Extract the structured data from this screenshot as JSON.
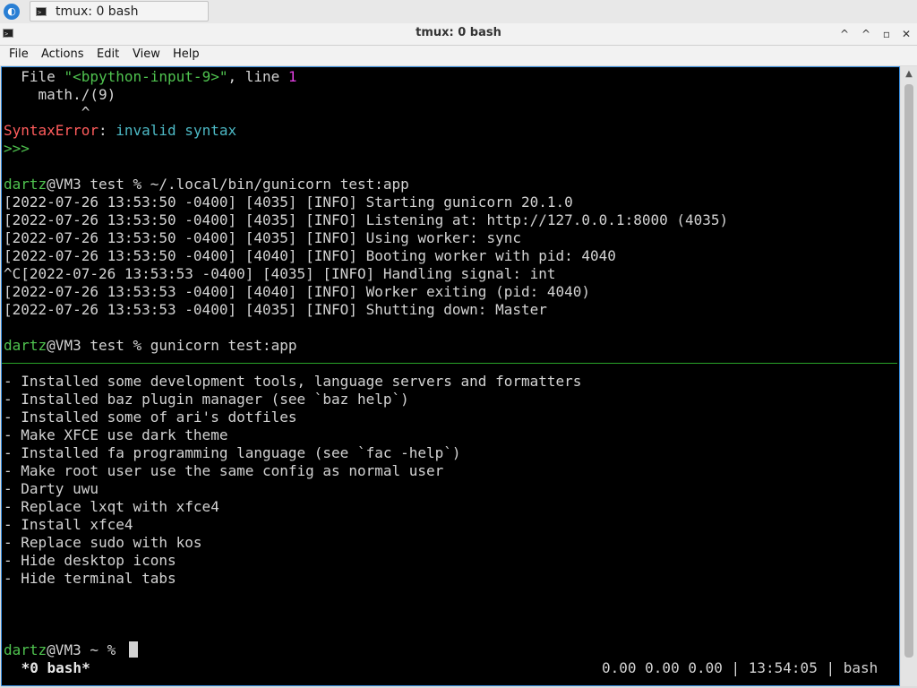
{
  "taskbar": {
    "task_label": "tmux: 0 bash"
  },
  "window": {
    "title": "tmux: 0 bash",
    "minimize_glyph": "^",
    "maximize_glyph": "^",
    "restore_glyph": "▫",
    "close_glyph": "✕"
  },
  "menu": {
    "file": "File",
    "actions": "Actions",
    "edit": "Edit",
    "view": "View",
    "help": "Help"
  },
  "icons": {
    "terminal_glyph": ">_",
    "app_logo_glyph": "◐",
    "scroll_up_glyph": "▲"
  },
  "colors": {
    "prompt_green": "#4fc34f",
    "error_red": "#ff5c5c",
    "cyan": "#4cb8c4",
    "magenta": "#e040e0",
    "selection_blue": "#3a8fe0"
  },
  "terminal": {
    "traceback": {
      "file_prefix": "  File ",
      "file_name": "\"<bpython-input-9>\"",
      "line_text": ", line ",
      "line_no": "1",
      "code": "    math./(9)",
      "caret": "         ^",
      "error_name": "SyntaxError",
      "error_sep": ": ",
      "error_msg": "invalid syntax",
      "repl_prompt": ">>>"
    },
    "prompt1": {
      "user": "dartz",
      "rest": "@VM3 test % ~/.local/bin/gunicorn test:app"
    },
    "log_lines": [
      "[2022-07-26 13:53:50 -0400] [4035] [INFO] Starting gunicorn 20.1.0",
      "[2022-07-26 13:53:50 -0400] [4035] [INFO] Listening at: http://127.0.0.1:8000 (4035)",
      "[2022-07-26 13:53:50 -0400] [4035] [INFO] Using worker: sync",
      "[2022-07-26 13:53:50 -0400] [4040] [INFO] Booting worker with pid: 4040",
      "^C[2022-07-26 13:53:53 -0400] [4035] [INFO] Handling signal: int",
      "[2022-07-26 13:53:53 -0400] [4040] [INFO] Worker exiting (pid: 4040)",
      "[2022-07-26 13:53:53 -0400] [4035] [INFO] Shutting down: Master"
    ],
    "prompt2": {
      "user": "dartz",
      "rest": "@VM3 test % gunicorn test:app"
    },
    "changelog": [
      "- Installed some development tools, language servers and formatters",
      "- Installed baz plugin manager (see `baz help`)",
      "- Installed some of ari's dotfiles",
      "- Make XFCE use dark theme",
      "- Installed fa programming language (see `fac -help`)",
      "- Make root user use the same config as normal user",
      "- Darty uwu",
      "- Replace lxqt with xfce4",
      "- Install xfce4",
      "- Replace sudo with kos",
      "- Hide desktop icons",
      "- Hide terminal tabs"
    ],
    "prompt3": {
      "user": "dartz",
      "rest": "@VM3 ~ % "
    }
  },
  "tmux_status": {
    "window": " *0 bash*",
    "right": "0.00 0.00 0.00 | 13:54:05 | bash"
  }
}
